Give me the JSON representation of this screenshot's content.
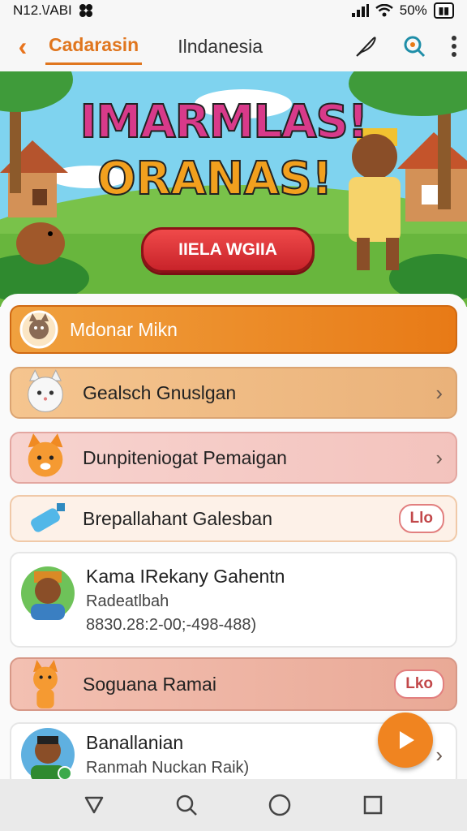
{
  "status": {
    "time": "N12.\\/ABI",
    "battery": "50%"
  },
  "appbar": {
    "tabs": [
      "Cadarasin",
      "Ilndanesia"
    ]
  },
  "hero": {
    "title_line1": "IMARMLAS!",
    "title_line2": "ORANAS!",
    "button": "IIELA WGIIA"
  },
  "list": {
    "items": [
      {
        "label": "Mdonar Mikn"
      },
      {
        "label": "Gealsch Gnuslgan"
      },
      {
        "label": "Dunpiteniogat Pemaigan"
      },
      {
        "label": "Brepallahant Galesban",
        "pill": "Llo"
      },
      {
        "title": "Kama IRekany Gahentn",
        "subtitle": "Radeatlbah",
        "phone": "8830.28:2-00;-498-488)"
      },
      {
        "label": "Soguana Ramai",
        "pill": "Lko"
      },
      {
        "title": "Banallanian",
        "subtitle": "Ranmah Nuckan Raik)"
      }
    ]
  },
  "colors": {
    "accent": "#e8741d",
    "brand_orange": "#f08420",
    "pill_text": "#c2484a"
  },
  "icons": [
    "back-arrow-icon",
    "feather-icon",
    "search-icon",
    "more-vert-icon",
    "chevron-right-icon",
    "play-icon",
    "nav-back-icon",
    "nav-search-icon",
    "nav-home-icon",
    "nav-recents-icon"
  ]
}
